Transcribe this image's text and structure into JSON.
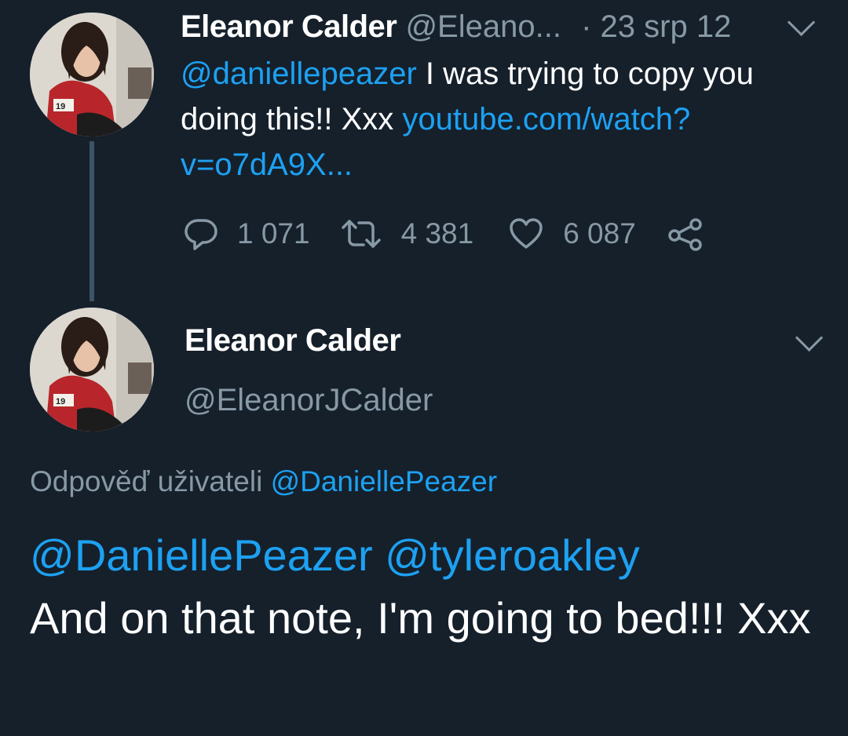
{
  "tweet1": {
    "author_name": "Eleanor Calder",
    "author_handle": "@Eleano...",
    "separator": "·",
    "date": "23 srp 12",
    "mention": "@daniellepeazer",
    "text_part1": " I was trying to copy you doing this!! Xxx ",
    "link": "youtube.com/watch?v=o7dA9X...",
    "replies": "1 071",
    "retweets": "4 381",
    "likes": "6 087"
  },
  "tweet2": {
    "author_name": "Eleanor Calder",
    "author_handle": "@EleanorJCalder",
    "replying_prefix": "Odpověď uživateli",
    "replying_to": "@DaniellePeazer",
    "mentions": "@DaniellePeazer @tyleroakley",
    "text": "And on that note, I'm going to bed!!! Xxx"
  },
  "icons": {
    "reply": "reply-icon",
    "retweet": "retweet-icon",
    "like": "heart-icon",
    "share": "share-icon",
    "menu": "chevron-down-icon"
  },
  "colors": {
    "background": "#15202b",
    "link": "#1da1f2",
    "muted": "#8899a6",
    "text": "#ffffff"
  }
}
